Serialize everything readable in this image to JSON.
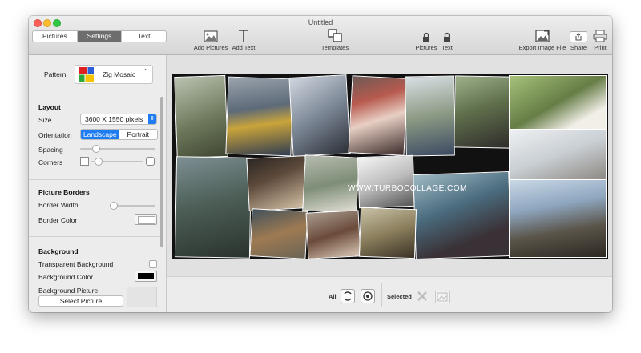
{
  "window": {
    "title": "Untitled"
  },
  "tabs": [
    {
      "label": "Pictures",
      "active": false
    },
    {
      "label": "Settings",
      "active": true
    },
    {
      "label": "Text",
      "active": false
    }
  ],
  "toolbar": {
    "add_pictures": "Add Pictures",
    "add_text": "Add Text",
    "templates": "Templates",
    "lock_pictures": "Pictures",
    "lock_text": "Text",
    "export": "Export Image File",
    "share": "Share",
    "print": "Print"
  },
  "sidebar": {
    "pattern_label": "Pattern",
    "pattern_value": "Zig Mosaic",
    "layout_header": "Layout",
    "size_label": "Size",
    "size_value": "3600 X 1550 pixels",
    "orientation_label": "Orientation",
    "orientation_landscape": "Landscape",
    "orientation_portrait": "Portrait",
    "spacing_label": "Spacing",
    "spacing_value": 0.2,
    "corners_label": "Corners",
    "corners_value": 0.05,
    "borders_header": "Picture Borders",
    "border_width_label": "Border Width",
    "border_width_value": 0,
    "border_color_label": "Border Color",
    "border_color": "#ffffff",
    "background_header": "Background",
    "transparent_bg_label": "Transparent Background",
    "bg_color_label": "Background Color",
    "bg_color": "#000000",
    "bg_picture_label": "Background Picture",
    "select_picture_button": "Select Picture"
  },
  "collage": {
    "watermark": "WWW.TURBOCOLLAGE.COM"
  },
  "bottom": {
    "all_label": "All",
    "selected_label": "Selected"
  },
  "colors": {
    "accent": "#1e7cf2",
    "tab_active": "#6d6d6d"
  }
}
